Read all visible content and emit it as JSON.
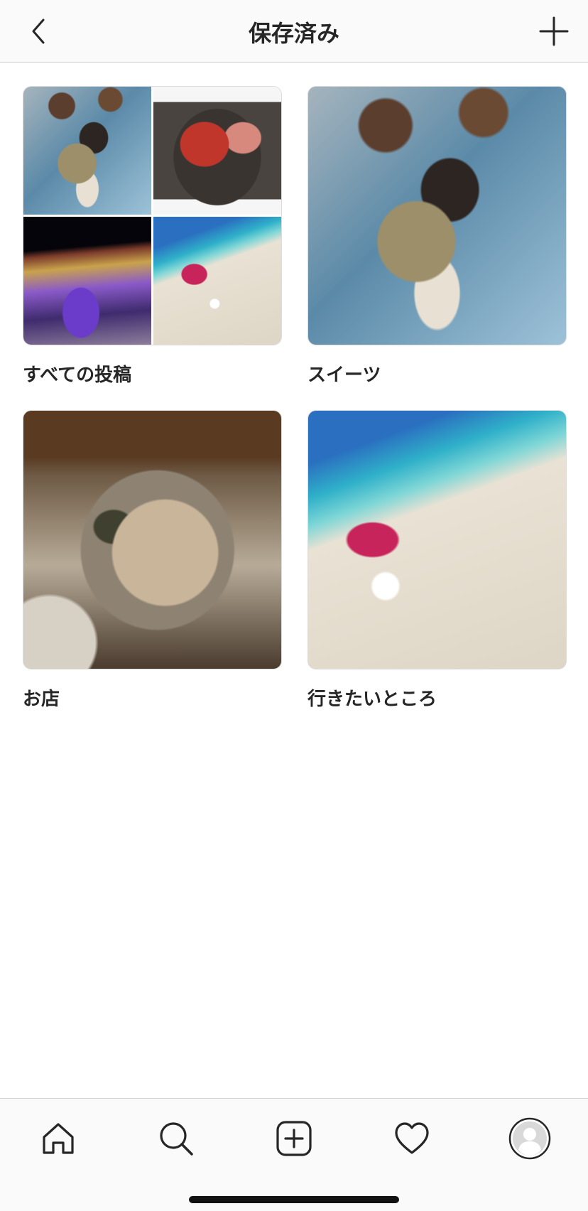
{
  "header": {
    "title": "保存済み",
    "back_icon": "chevron-left-icon",
    "add_icon": "plus-icon"
  },
  "collections": [
    {
      "label": "すべての投稿",
      "preview": [
        "sweets",
        "meat",
        "illumination",
        "beach"
      ]
    },
    {
      "label": "スイーツ",
      "preview": [
        "sweets"
      ]
    },
    {
      "label": "お店",
      "preview": [
        "oyster"
      ]
    },
    {
      "label": "行きたいところ",
      "preview": [
        "beach"
      ]
    }
  ],
  "tabbar": {
    "items": [
      "home-icon",
      "search-icon",
      "new-post-icon",
      "heart-icon",
      "profile-avatar"
    ],
    "active": "profile-avatar"
  }
}
